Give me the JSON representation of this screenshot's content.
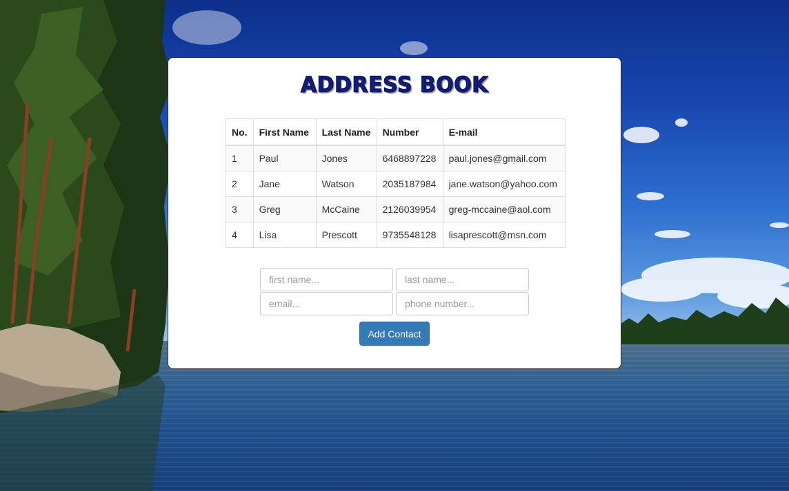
{
  "page": {
    "title": "ADDRESS BOOK"
  },
  "table": {
    "headers": [
      "No.",
      "First Name",
      "Last Name",
      "Number",
      "E-mail"
    ],
    "rows": [
      {
        "no": "1",
        "first": "Paul",
        "last": "Jones",
        "number": "6468897228",
        "email": "paul.jones@gmail.com"
      },
      {
        "no": "2",
        "first": "Jane",
        "last": "Watson",
        "number": "2035187984",
        "email": "jane.watson@yahoo.com"
      },
      {
        "no": "3",
        "first": "Greg",
        "last": "McCaine",
        "number": "2126039954",
        "email": "greg-mccaine@aol.com"
      },
      {
        "no": "4",
        "first": "Lisa",
        "last": "Prescott",
        "number": "9735548128",
        "email": "lisaprescott@msn.com"
      }
    ]
  },
  "form": {
    "first_name_placeholder": "first name...",
    "last_name_placeholder": "last name...",
    "email_placeholder": "email...",
    "phone_placeholder": "phone number...",
    "submit_label": "Add Contact"
  },
  "colors": {
    "title": "#121d7a",
    "button": "#337ab7",
    "card_background": "#ffffff"
  }
}
